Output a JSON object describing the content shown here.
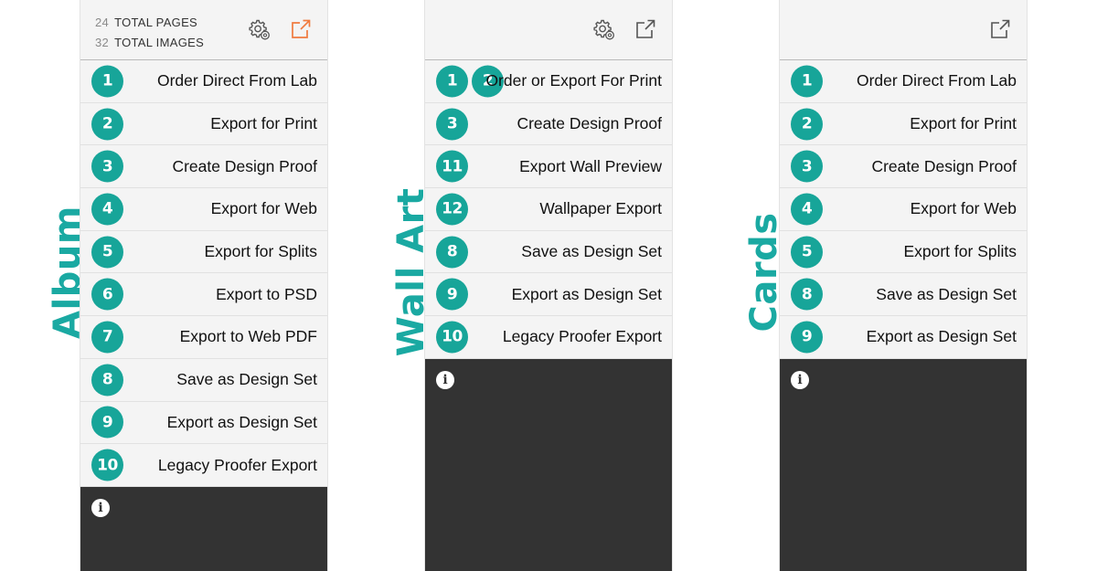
{
  "album": {
    "side_label": "Album",
    "stats": [
      {
        "num": "24",
        "label": "TOTAL PAGES"
      },
      {
        "num": "32",
        "label": "TOTAL IMAGES"
      }
    ],
    "items": [
      {
        "badges": [
          "1"
        ],
        "label": "Order Direct From Lab"
      },
      {
        "badges": [
          "2"
        ],
        "label": "Export for Print"
      },
      {
        "badges": [
          "3"
        ],
        "label": "Create Design Proof"
      },
      {
        "badges": [
          "4"
        ],
        "label": "Export for Web"
      },
      {
        "badges": [
          "5"
        ],
        "label": "Export for Splits"
      },
      {
        "badges": [
          "6"
        ],
        "label": "Export to PSD"
      },
      {
        "badges": [
          "7"
        ],
        "label": "Export to Web PDF"
      },
      {
        "badges": [
          "8"
        ],
        "label": "Save as Design Set"
      },
      {
        "badges": [
          "9"
        ],
        "label": "Export as Design Set"
      },
      {
        "badges": [
          "10"
        ],
        "label": "Legacy Proofer Export"
      }
    ]
  },
  "wall_art": {
    "side_label": "Wall Art",
    "items": [
      {
        "badges": [
          "1",
          "2"
        ],
        "label": "Order or Export For Print"
      },
      {
        "badges": [
          "3"
        ],
        "label": "Create Design Proof"
      },
      {
        "badges": [
          "11"
        ],
        "label": "Export Wall Preview"
      },
      {
        "badges": [
          "12"
        ],
        "label": "Wallpaper Export"
      },
      {
        "badges": [
          "8"
        ],
        "label": "Save as Design Set"
      },
      {
        "badges": [
          "9"
        ],
        "label": "Export as Design Set"
      },
      {
        "badges": [
          "10"
        ],
        "label": "Legacy Proofer Export"
      }
    ]
  },
  "cards": {
    "side_label": "Cards",
    "items": [
      {
        "badges": [
          "1"
        ],
        "label": "Order Direct From Lab"
      },
      {
        "badges": [
          "2"
        ],
        "label": "Export for Print"
      },
      {
        "badges": [
          "3"
        ],
        "label": "Create Design Proof"
      },
      {
        "badges": [
          "4"
        ],
        "label": "Export for Web"
      },
      {
        "badges": [
          "5"
        ],
        "label": "Export for Splits"
      },
      {
        "badges": [
          "8"
        ],
        "label": "Save as Design Set"
      },
      {
        "badges": [
          "9"
        ],
        "label": "Export as Design Set"
      }
    ]
  },
  "icons": {
    "settings": "gear-icon",
    "export": "export-icon",
    "info": "info-icon"
  },
  "colors": {
    "accent": "#1aa9a2",
    "badge": "#17a599",
    "export_active": "#f07b3f",
    "export_inactive": "#555555",
    "dark_area": "#333333"
  }
}
